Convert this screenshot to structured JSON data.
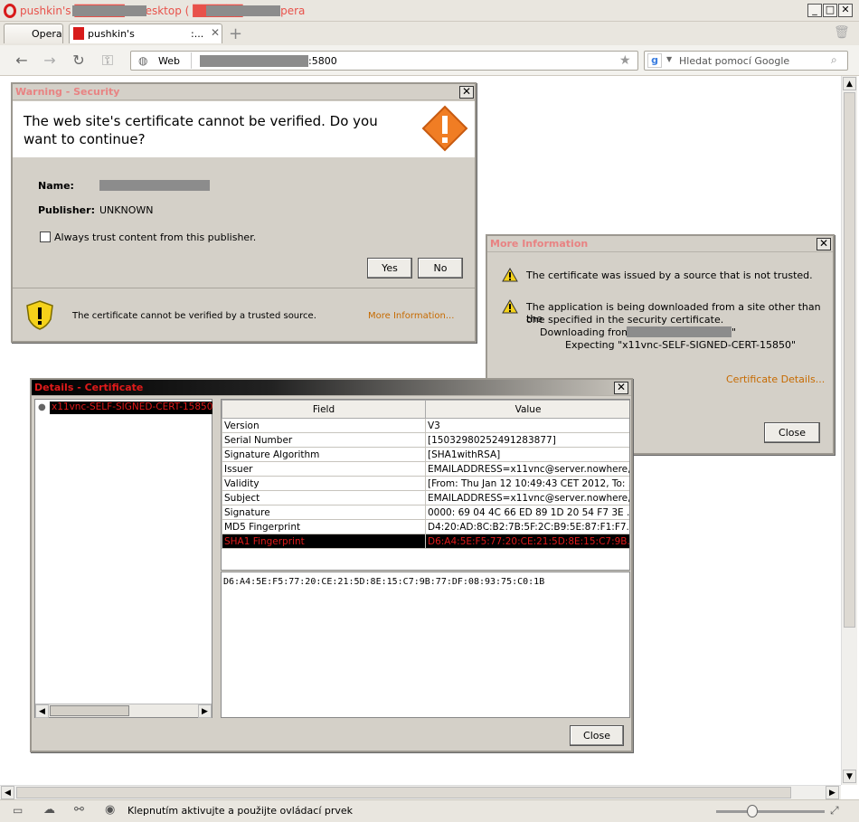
{
  "browser": {
    "window_title": "pushkin's ██████ 0 desktop ( ██████ :0) - Opera",
    "opera_menu": "Opera",
    "tab_title": "pushkin's",
    "tab_title_suffix": ":...",
    "address_label": "Web",
    "address_port": ":5800",
    "search_placeholder": "Hledat pomocí Google",
    "status_text": "Klepnutím aktivujte a použijte ovládací prvek"
  },
  "security_dialog": {
    "title": "Warning - Security",
    "question": "The web site's certificate cannot be verified.  Do you want to continue?",
    "name_label": "Name:",
    "publisher_label": "Publisher:",
    "publisher_value": "UNKNOWN",
    "checkbox_label": "Always trust content from this publisher.",
    "yes_label": "Yes",
    "no_label": "No",
    "footer_text": "The certificate cannot be verified by a trusted source.",
    "more_info_link": "More Information..."
  },
  "more_info_dialog": {
    "title": "More Information",
    "warning1": "The certificate was issued by a source that is not trusted.",
    "warning2_line1": "The application is being downloaded from a site other than the",
    "warning2_line2": "one specified in the security certificate.",
    "downloading_from": "Downloading from \"",
    "downloading_from_end": "\"",
    "expecting": "Expecting \"x11vnc-SELF-SIGNED-CERT-15850\"",
    "cert_details_link": "Certificate Details...",
    "close_label": "Close"
  },
  "details_dialog": {
    "title": "Details - Certificate",
    "tree_item": "x11vnc-SELF-SIGNED-CERT-15850 (",
    "col_field": "Field",
    "col_value": "Value",
    "rows": [
      {
        "field": "Version",
        "value": "V3"
      },
      {
        "field": "Serial Number",
        "value": "[1503298025249128387​7]"
      },
      {
        "field": "Signature Algorithm",
        "value": "[SHA1withRSA]"
      },
      {
        "field": "Issuer",
        "value": "EMAILADDRESS=x11vnc@server.nowhere,..."
      },
      {
        "field": "Validity",
        "value": "[From: Thu Jan 12 10:49:43 CET 2012, To: ..."
      },
      {
        "field": "Subject",
        "value": "EMAILADDRESS=x11vnc@server.nowhere,..."
      },
      {
        "field": "Signature",
        "value": "0000: 69 04 4C 66 ED 89 1D 20   54 F7 3E ..."
      },
      {
        "field": "MD5 Fingerprint",
        "value": "D4:20:AD:8C:B2:7B:5F:2C:B9:5E:87:F1:F7..."
      },
      {
        "field": "SHA1 Fingerprint",
        "value": "D6:A4:5E:F5:77:20:CE:21:5D:8E:15:C7:9B..."
      }
    ],
    "detail_text": "D6:A4:5E:F5:77:20:CE:21:5D:8E:15:C7:9B:77:DF:08:93:75:C0:1B",
    "close_label": "Close"
  },
  "colors": {
    "title_red": "#e8524b",
    "link_orange": "#c66a00",
    "selection_bg": "#000000",
    "selection_text": "#e01a1a",
    "dialog_gray": "#d4d0c8"
  }
}
